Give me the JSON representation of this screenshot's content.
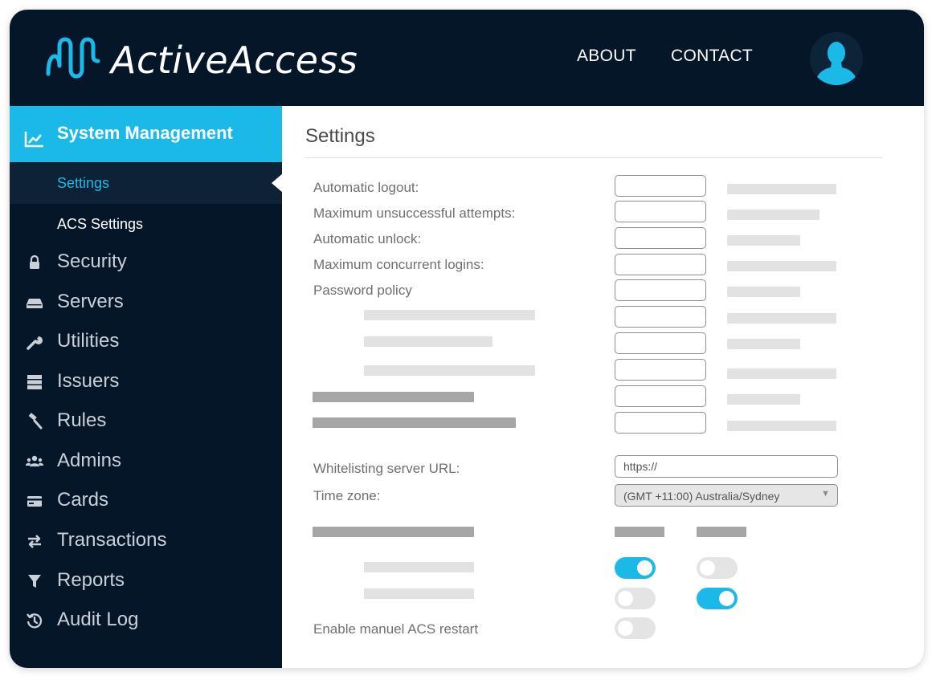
{
  "brand": {
    "name": "ActiveAccess",
    "accent": "#1ab9e8",
    "dark": "#061629"
  },
  "header": {
    "nav": [
      {
        "label": "ABOUT"
      },
      {
        "label": "CONTACT"
      }
    ],
    "avatar_icon": "user-avatar-icon"
  },
  "sidebar": {
    "section": {
      "label": "System Management",
      "icon": "chart-icon"
    },
    "subitems": [
      {
        "label": "Settings",
        "active": true
      },
      {
        "label": "ACS Settings",
        "active": false
      }
    ],
    "items": [
      {
        "label": "Security",
        "icon": "lock-icon"
      },
      {
        "label": "Servers",
        "icon": "server-drive-icon"
      },
      {
        "label": "Utilities",
        "icon": "wrench-icon"
      },
      {
        "label": "Issuers",
        "icon": "stack-icon"
      },
      {
        "label": "Rules",
        "icon": "gavel-icon"
      },
      {
        "label": "Admins",
        "icon": "users-icon"
      },
      {
        "label": "Cards",
        "icon": "card-icon"
      },
      {
        "label": "Transactions",
        "icon": "arrows-icon"
      },
      {
        "label": "Reports",
        "icon": "filter-icon"
      },
      {
        "label": "Audit Log",
        "icon": "history-icon"
      }
    ]
  },
  "main": {
    "title": "Settings",
    "fields": [
      {
        "label": "Automatic logout:",
        "value": ""
      },
      {
        "label": "Maximum unsuccessful attempts:",
        "value": ""
      },
      {
        "label": "Automatic unlock:",
        "value": ""
      },
      {
        "label": "Maximum concurrent logins:",
        "value": ""
      },
      {
        "label": "Password policy",
        "value": ""
      }
    ],
    "url": {
      "label": "Whitelisting server URL:",
      "value": "https://"
    },
    "timezone": {
      "label": "Time zone:",
      "value": "(GMT +11:00) Australia/Sydney"
    },
    "toggles": {
      "row1": [
        true,
        false
      ],
      "row2": [
        false,
        true
      ],
      "acs_restart": {
        "label": "Enable manuel ACS restart",
        "on": false
      }
    }
  }
}
